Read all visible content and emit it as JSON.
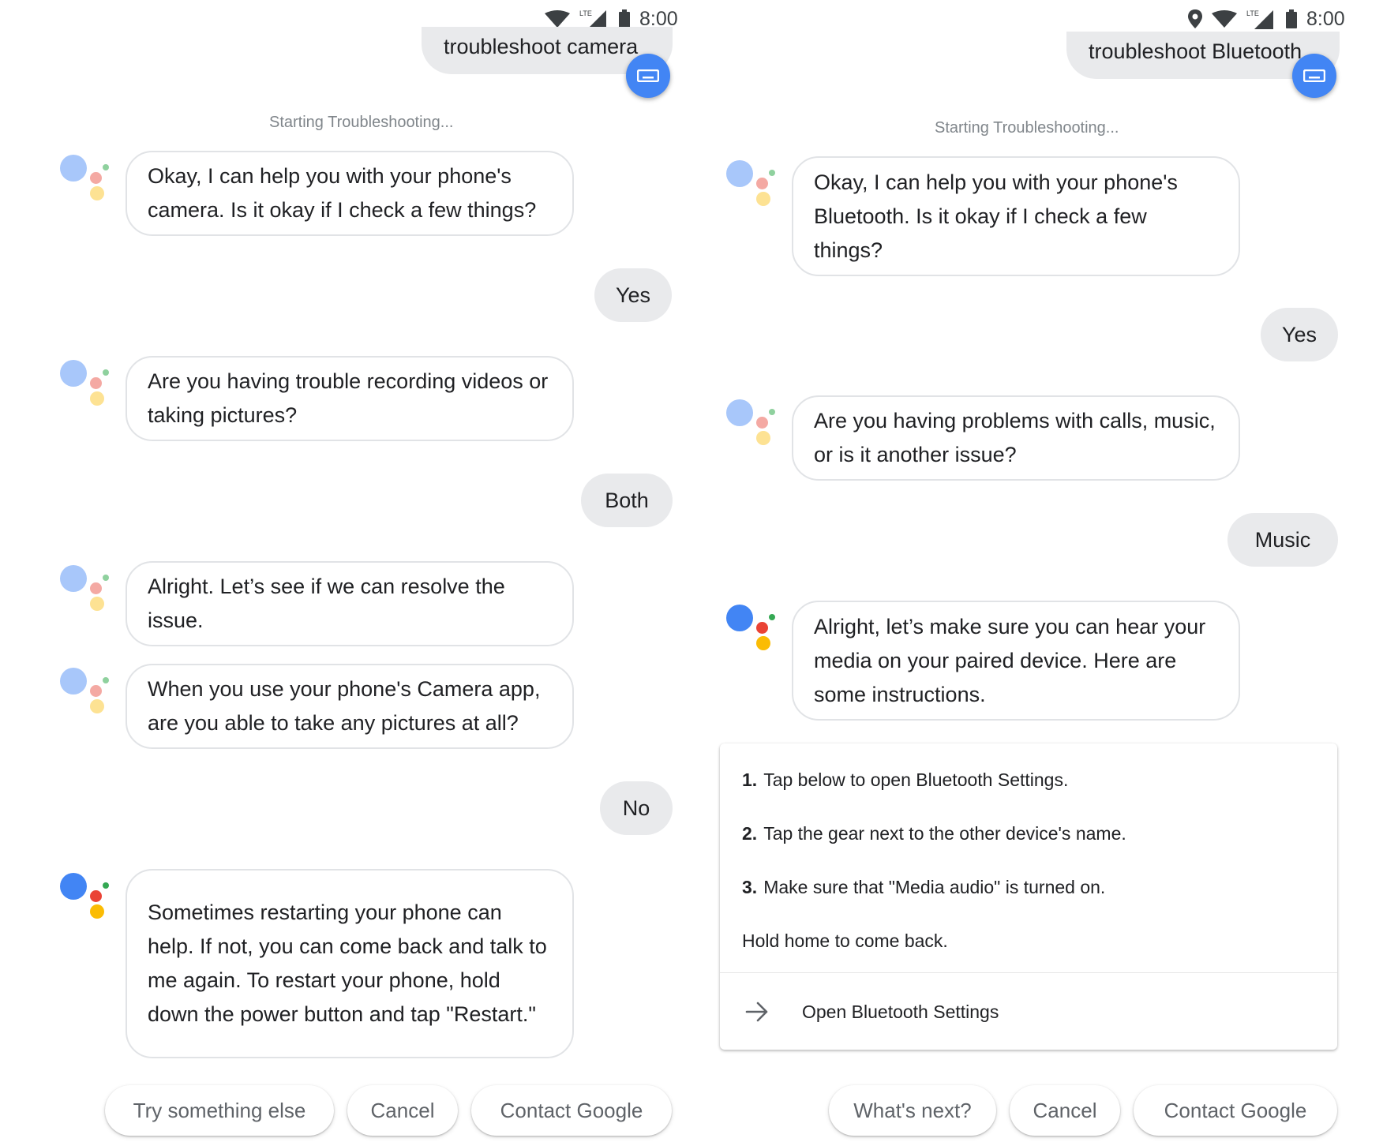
{
  "left": {
    "status_bar": {
      "time": "8:00",
      "icons": [
        "wifi-icon",
        "lte-signal-icon",
        "battery-icon"
      ]
    },
    "query": "troubleshoot camera",
    "status_line": "Starting Troubleshooting...",
    "messages": [
      {
        "text": "Okay, I can help you with your phone's camera. Is it okay if I check a few things?"
      },
      {
        "reply": "Yes"
      },
      {
        "text": "Are you having trouble recording videos or taking pictures?"
      },
      {
        "reply": "Both"
      },
      {
        "text": "Alright. Let’s see if we can resolve the issue."
      },
      {
        "text": "When you use your phone's Camera app, are you able to take any pictures at all?"
      },
      {
        "reply": "No"
      },
      {
        "text": "Sometimes restarting your phone can help. If not, you can come back and talk to me again. To restart your phone, hold down the power button and tap \"Restart.\""
      }
    ],
    "suggestions": [
      "Try something else",
      "Cancel",
      "Contact Google"
    ]
  },
  "right": {
    "status_bar": {
      "time": "8:00",
      "icons": [
        "location-icon",
        "wifi-icon",
        "lte-signal-icon",
        "battery-icon"
      ]
    },
    "query": "troubleshoot Bluetooth",
    "status_line": "Starting Troubleshooting...",
    "messages": [
      {
        "text": "Okay, I can help you with your phone's Bluetooth. Is it okay if I check a few things?"
      },
      {
        "reply": "Yes"
      },
      {
        "text": "Are you having problems with calls, music, or is it another issue?"
      },
      {
        "reply": "Music"
      },
      {
        "text": "Alright, let’s make sure you can hear your media on your paired device. Here are some instructions."
      }
    ],
    "instructions": {
      "steps": [
        {
          "num": "1.",
          "text": "Tap below to open Bluetooth Settings."
        },
        {
          "num": "2.",
          "text": "Tap the gear next to the other device's name."
        },
        {
          "num": "3.",
          "text": "Make sure that \"Media audio\" is turned on."
        }
      ],
      "note": "Hold home to come back.",
      "action_label": "Open Bluetooth Settings"
    },
    "suggestions": [
      "What's next?",
      "Cancel",
      "Contact Google"
    ]
  },
  "colors": {
    "google_blue": "#4285f4",
    "google_red": "#ea4335",
    "google_yellow": "#fbbc04",
    "google_green": "#34a853",
    "chip_gray": "#e9eaec"
  }
}
